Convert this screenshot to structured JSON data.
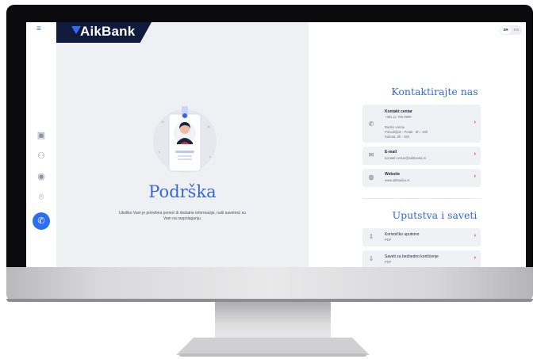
{
  "brand": {
    "name": "AikBank"
  },
  "language": {
    "active": "SR",
    "other": "EN"
  },
  "support": {
    "title": "Podrška",
    "description": "Ukoliko Vam je potrebna pomoć ili dodatne informacije, naši savetnici su Vam na raspolaganju."
  },
  "contact": {
    "title": "Kontaktirajte nas",
    "call_center": {
      "title": "Kontakt centar",
      "phone": "+381 11 785 9999",
      "hours_label": "Radno vreme",
      "hours_weekdays": "Ponedeljak - Petak - 8h - 20h",
      "hours_saturday": "Subota: 8h - 15h"
    },
    "email": {
      "title": "E-mail",
      "value": "kontakt.centar@aikbanka.rs"
    },
    "website": {
      "title": "Website",
      "value": "www.aikbanka.rs"
    }
  },
  "guides": {
    "title": "Uputstva i saveti",
    "items": [
      {
        "title": "Korisničko uputstvo",
        "type": "PDF"
      },
      {
        "title": "Saveti za bezbedno korišćenje",
        "type": "PDF"
      }
    ]
  },
  "icons": {
    "menu": "hamburger-menu-icon",
    "accounts": "wallet-icon",
    "profile": "user-icon",
    "cards": "eye-icon",
    "location": "location-pin-icon",
    "support": "phone-icon"
  },
  "colors": {
    "accent": "#3568d4",
    "brand_dark": "#0f1a3c",
    "arrow": "#e5263e",
    "active": "#2d6ef0"
  }
}
